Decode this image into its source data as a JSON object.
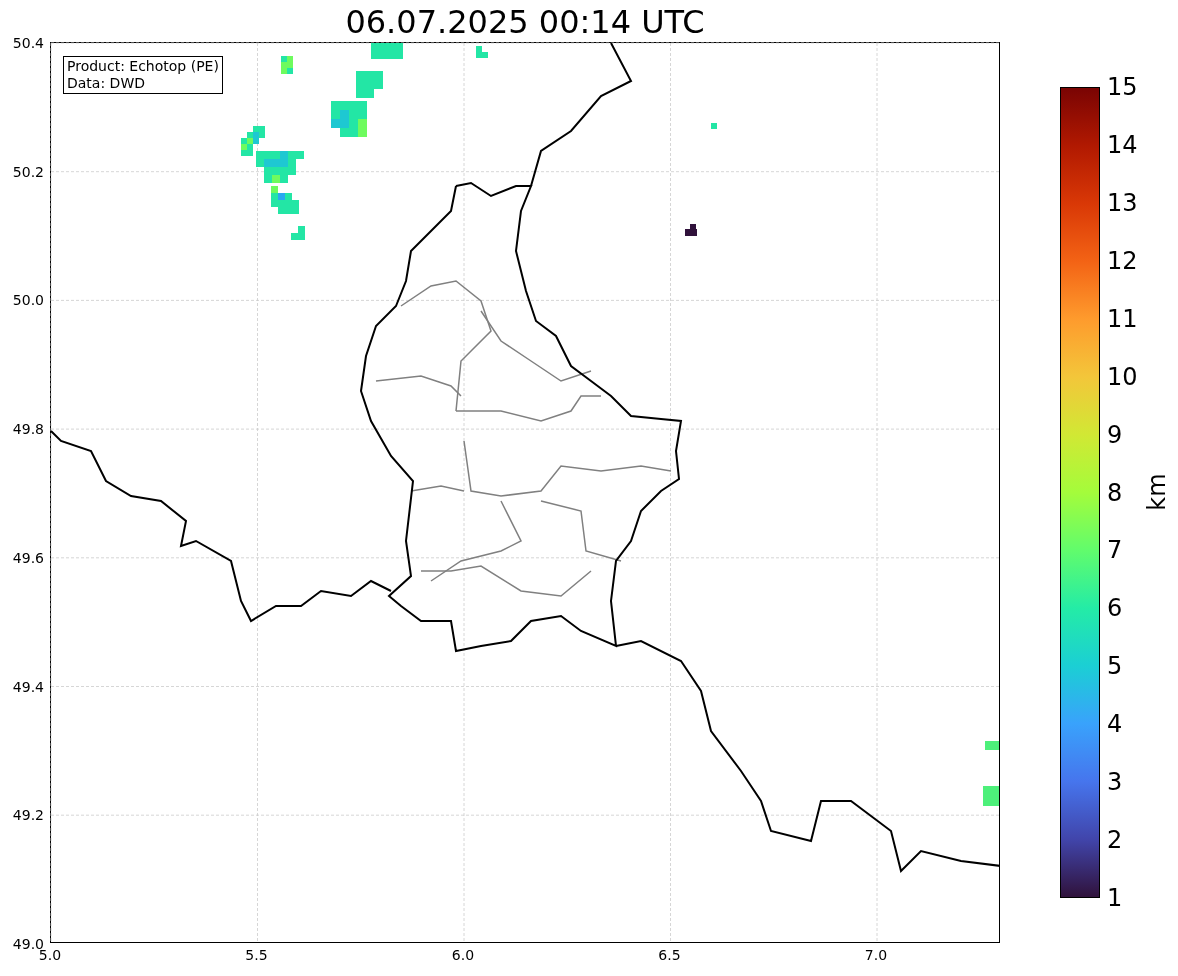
{
  "title": "06.07.2025 00:14 UTC",
  "legend": {
    "lines": [
      "Product: Echotop (PE)",
      "Data: DWD"
    ]
  },
  "map": {
    "x_ticks": [
      "5.0",
      "5.5",
      "6.0",
      "6.5",
      "7.0"
    ],
    "y_ticks": [
      "50.4",
      "50.2",
      "50.0",
      "49.8",
      "49.6",
      "49.4",
      "49.2",
      "49.0"
    ]
  },
  "colorbar": {
    "label": "km",
    "ticks": [
      "15",
      "14",
      "13",
      "12",
      "11",
      "10",
      "9",
      "8",
      "7",
      "6",
      "5",
      "4",
      "3",
      "2",
      "1"
    ]
  }
}
